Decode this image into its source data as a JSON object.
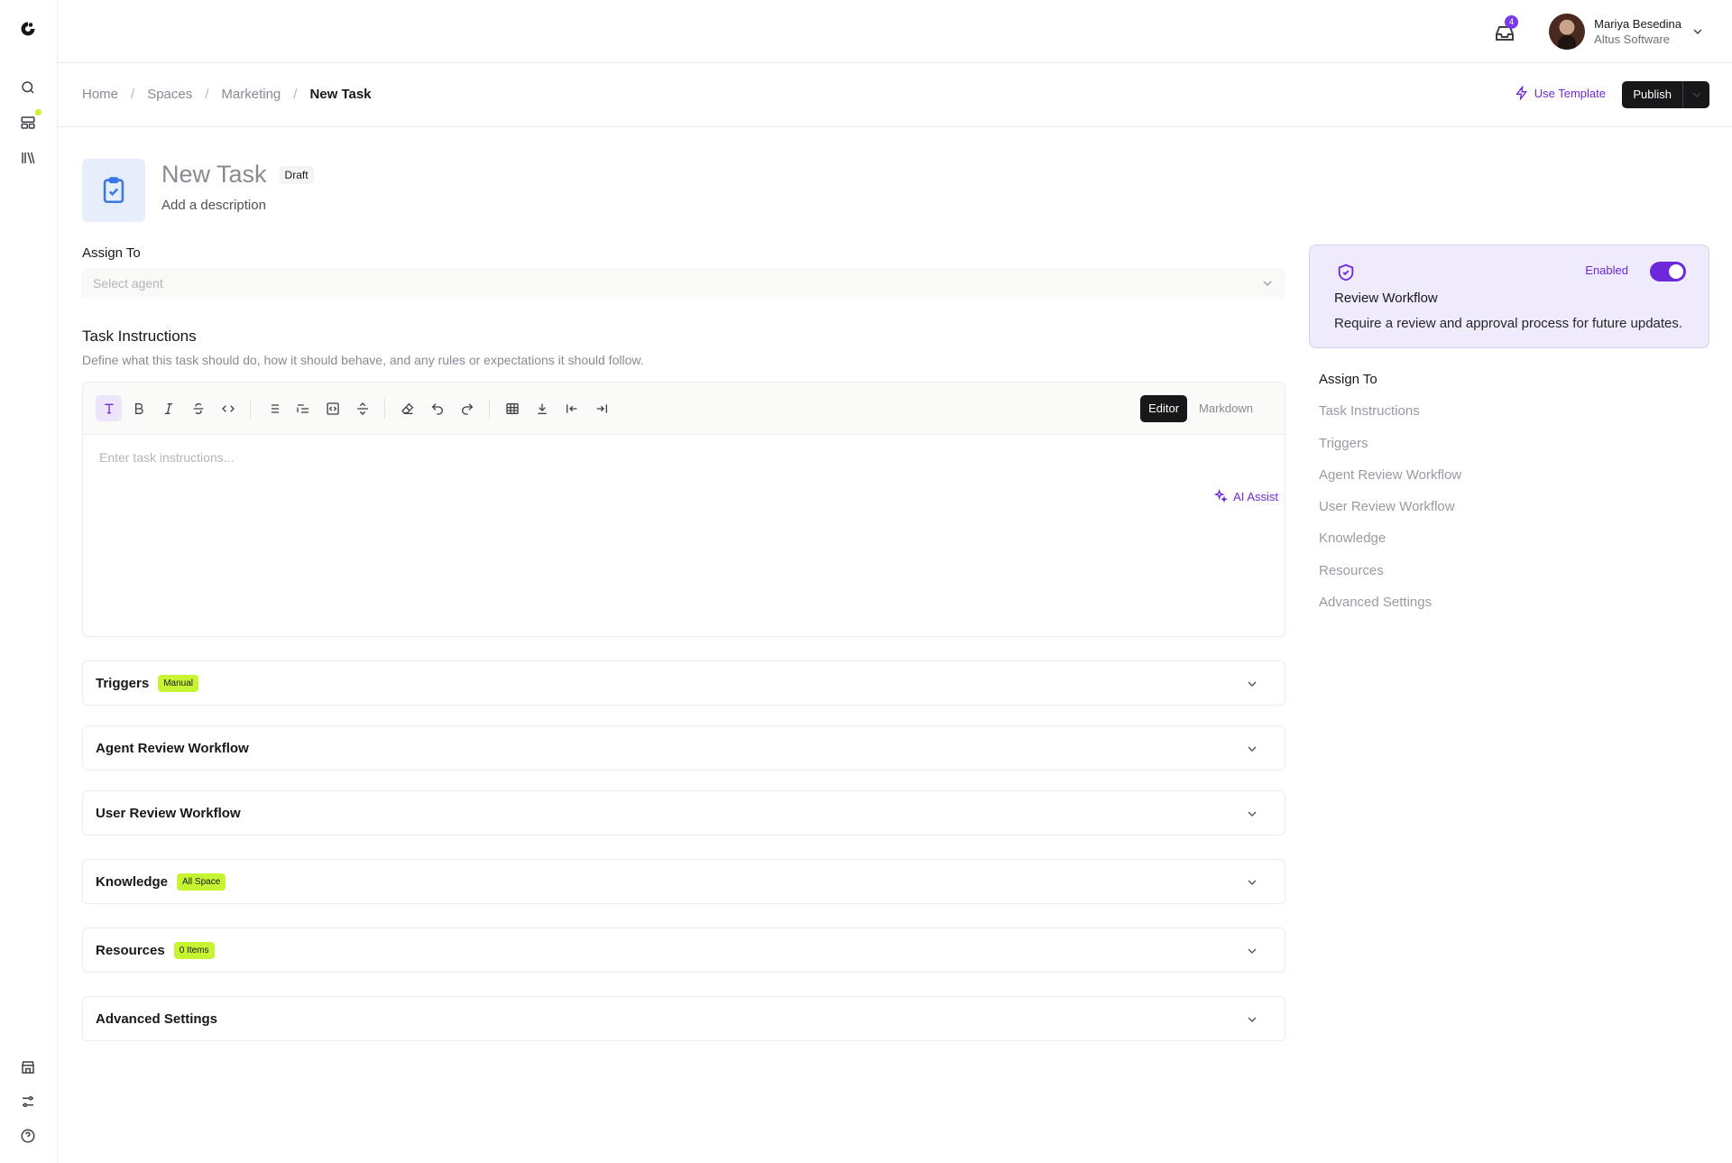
{
  "top": {
    "inbox_count": "4",
    "user_name": "Mariya Besedina",
    "user_org": "Altus Software"
  },
  "breadcrumb": {
    "items": [
      "Home",
      "Spaces",
      "Marketing"
    ],
    "current": "New Task",
    "separator": "/"
  },
  "actions": {
    "use_template": "Use Template",
    "publish": "Publish"
  },
  "task": {
    "title": "New Task",
    "status": "Draft",
    "description_placeholder": "Add a description"
  },
  "assign": {
    "label": "Assign To",
    "placeholder": "Select agent"
  },
  "instructions": {
    "title": "Task Instructions",
    "subtitle": "Define what this task should do, how it should behave, and any rules or expectations it should follow.",
    "ai_assist": "AI Assist",
    "placeholder": "Enter task instructions...",
    "modes": [
      "Editor",
      "Markdown"
    ],
    "active_mode": "Editor",
    "toolbar": [
      "text-style-icon",
      "bold-icon",
      "italic-icon",
      "strikethrough-icon",
      "code-icon",
      "bullet-list-icon",
      "ordered-list-icon",
      "code-block-icon",
      "horizontal-rule-icon",
      "clear-format-icon",
      "undo-icon",
      "redo-icon",
      "table-icon",
      "download-icon",
      "outdent-icon",
      "indent-icon"
    ]
  },
  "sections": [
    {
      "title": "Triggers",
      "badge": "Manual"
    },
    {
      "title": "Agent Review Workflow",
      "badge": ""
    },
    {
      "title": "User Review Workflow",
      "badge": ""
    },
    {
      "title": "Knowledge",
      "badge": "All Space"
    },
    {
      "title": "Resources",
      "badge": "0 Items"
    },
    {
      "title": "Advanced Settings",
      "badge": ""
    }
  ],
  "review_card": {
    "enabled_label": "Enabled",
    "enabled": true,
    "title": "Review Workflow",
    "description": "Require a review and approval process for future updates."
  },
  "toc": {
    "items": [
      "Assign To",
      "Task Instructions",
      "Triggers",
      "Agent Review Workflow",
      "User Review Workflow",
      "Knowledge",
      "Resources",
      "Advanced Settings"
    ],
    "active": "Assign To"
  },
  "colors": {
    "accent": "#6d28d9",
    "highlight": "#c6f432",
    "dark": "#18181b",
    "card_bg": "#efeafc"
  }
}
